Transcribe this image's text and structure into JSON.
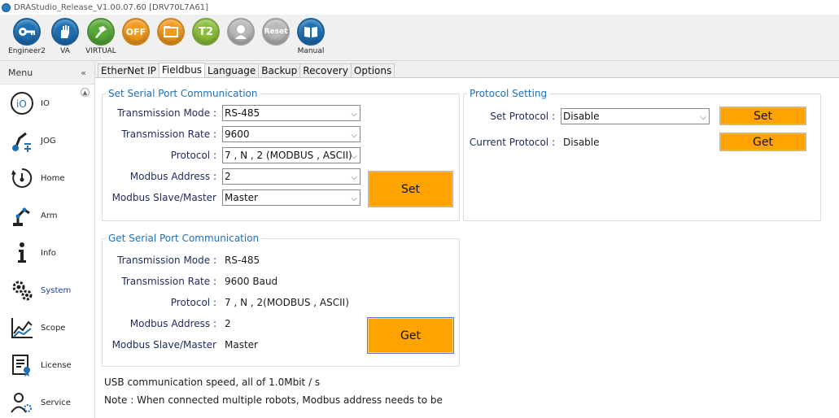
{
  "window": {
    "title": "DRAStudio_Release_V1.00.07.60 [DRV70L7A61]"
  },
  "toolbar": {
    "buttons": [
      {
        "label": "Engineer2",
        "icon": "key-icon",
        "color": "#1c6fb4"
      },
      {
        "label": "VA",
        "icon": "hand-icon",
        "color": "#1c6fb4"
      },
      {
        "label": "VIRTUAL",
        "icon": "virtual-icon",
        "color": "#58a838"
      },
      {
        "label": "",
        "icon_text": "OFF",
        "color": "#f39a1d"
      },
      {
        "label": "",
        "icon": "folder-icon",
        "color": "#f39a1d"
      },
      {
        "label": "",
        "icon_text": "T2",
        "color": "#8cbf3c"
      },
      {
        "label": "",
        "icon": "person-icon",
        "color": "#b9b9b9"
      },
      {
        "label": "",
        "icon_text": "Reset",
        "color": "#b9b9b9"
      },
      {
        "label": "Manual",
        "icon": "book-icon",
        "color": "#1c6fb4"
      }
    ]
  },
  "sidebar": {
    "header": "Menu",
    "collapse_glyph": "«",
    "items": [
      {
        "label": "IO"
      },
      {
        "label": "JOG"
      },
      {
        "label": "Home"
      },
      {
        "label": "Arm"
      },
      {
        "label": "Info"
      },
      {
        "label": "System",
        "active": true
      },
      {
        "label": "Scope"
      },
      {
        "label": "License"
      },
      {
        "label": "Service"
      }
    ]
  },
  "tabs": [
    {
      "label": "EtherNet IP"
    },
    {
      "label": "Fieldbus",
      "active": true
    },
    {
      "label": "Language"
    },
    {
      "label": "Backup"
    },
    {
      "label": "Recovery"
    },
    {
      "label": "Options"
    }
  ],
  "set_serial": {
    "title": "Set Serial Port Communication",
    "labels": {
      "mode": "Transmission Mode :",
      "rate": "Transmission Rate :",
      "protocol": "Protocol :",
      "address": "Modbus Address :",
      "role": "Modbus Slave/Master"
    },
    "values": {
      "mode": "RS-485",
      "rate": "9600",
      "protocol": "7 , N , 2 (MODBUS , ASCII)",
      "address": "2",
      "role": "Master"
    },
    "set_label": "Set"
  },
  "get_serial": {
    "title": "Get Serial Port Communication",
    "labels": {
      "mode": "Transmission Mode :",
      "rate": "Transmission Rate :",
      "protocol": "Protocol :",
      "address": "Modbus Address :",
      "role": "Modbus Slave/Master"
    },
    "values": {
      "mode": "RS-485",
      "rate": "9600 Baud",
      "protocol": "7 , N , 2(MODBUS , ASCII)",
      "address": "2",
      "role": "Master"
    },
    "get_label": "Get"
  },
  "protocol_setting": {
    "title": "Protocol Setting",
    "set_protocol_label": "Set Protocol :",
    "set_protocol_value": "Disable",
    "current_protocol_label": "Current Protocol :",
    "current_protocol_value": "Disable",
    "set_label": "Set",
    "get_label": "Get"
  },
  "notes": {
    "usb": "USB communication speed, all of 1.0Mbit / s",
    "modbus": "Note : When connected multiple robots, Modbus address needs to be"
  },
  "colors": {
    "accent_button": "#ffa300",
    "group_title": "#1f6fb6",
    "label_text": "#1e2a5c"
  }
}
